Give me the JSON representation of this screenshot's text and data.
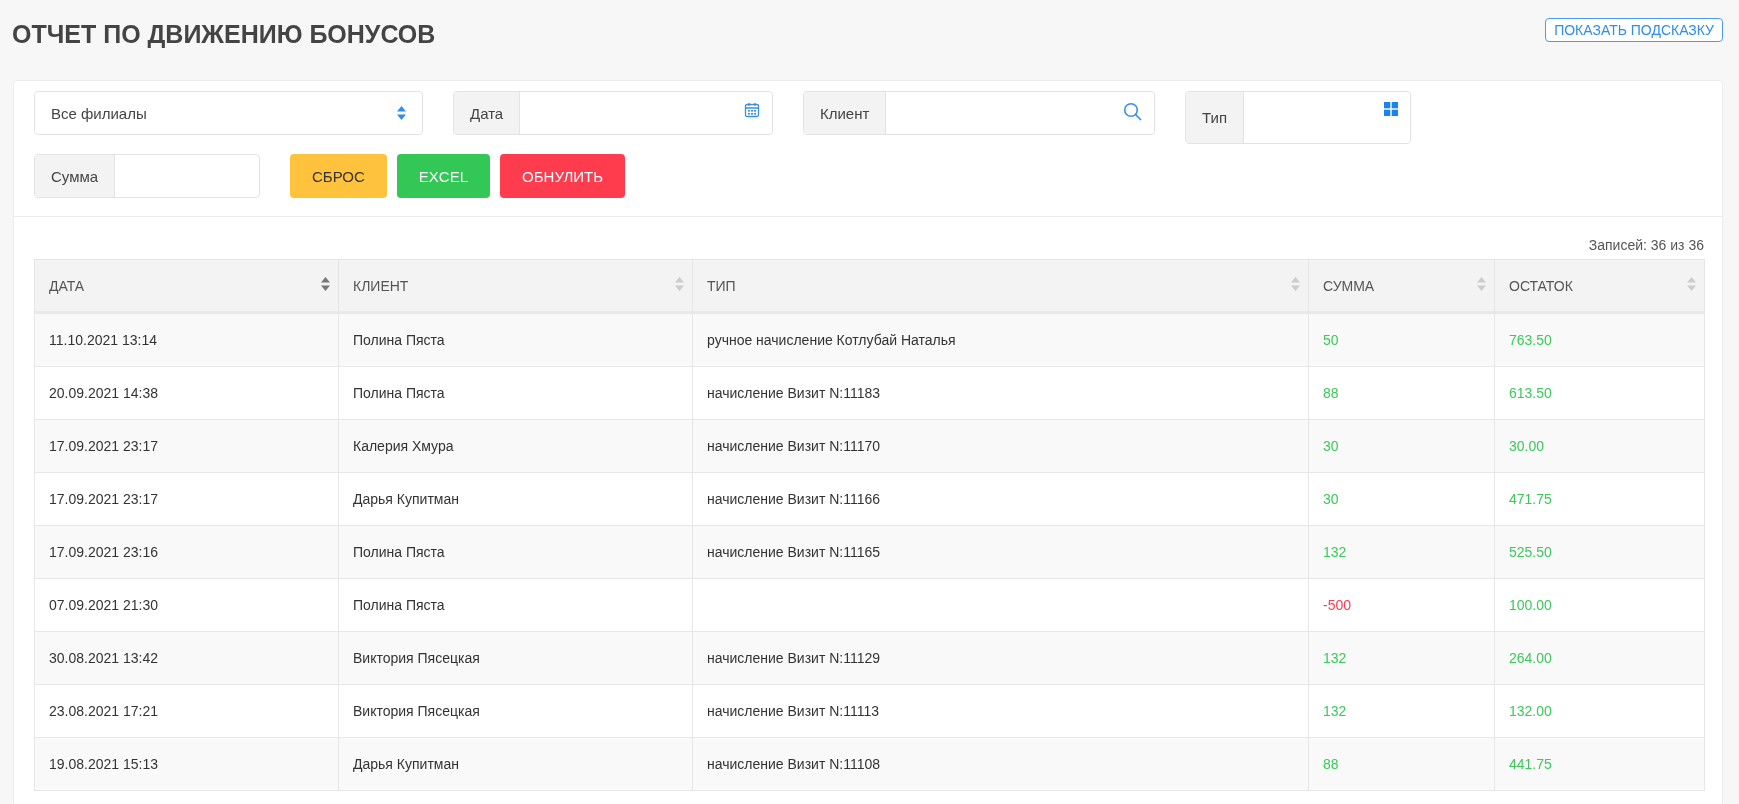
{
  "page": {
    "title": "ОТЧЕТ ПО ДВИЖЕНИЮ БОНУСОВ",
    "hint_button": "ПОКАЗАТЬ ПОДСКАЗКУ"
  },
  "filters": {
    "branch": {
      "value": "Все филиалы"
    },
    "date": {
      "label": "Дата"
    },
    "client": {
      "label": "Клиент"
    },
    "type": {
      "label": "Тип"
    },
    "sum": {
      "label": "Сумма"
    },
    "buttons": [
      {
        "label": "СБРОС",
        "kind": "warning"
      },
      {
        "label": "EXCEL",
        "kind": "success"
      },
      {
        "label": "ОБНУЛИТЬ",
        "kind": "danger"
      }
    ]
  },
  "table": {
    "records": "Записей: 36 из 36",
    "columns": [
      {
        "label": "ДАТА",
        "sorted": true
      },
      {
        "label": "КЛИЕНТ",
        "sorted": false
      },
      {
        "label": "ТИП",
        "sorted": false
      },
      {
        "label": "СУММА",
        "sorted": false
      },
      {
        "label": "ОСТАТОК",
        "sorted": false
      }
    ],
    "rows": [
      {
        "date": "11.10.2021 13:14",
        "client": "Полина Пяста",
        "type": "ручное начисление Котлубай Наталья",
        "amount": "50",
        "kind": "credit",
        "balance": "763.50"
      },
      {
        "date": "20.09.2021 14:38",
        "client": "Полина Пяста",
        "type": "начисление Визит N:11183",
        "amount": "88",
        "kind": "credit",
        "balance": "613.50"
      },
      {
        "date": "17.09.2021 23:17",
        "client": "Калерия Хмура",
        "type": "начисление Визит N:11170",
        "amount": "30",
        "kind": "credit",
        "balance": "30.00"
      },
      {
        "date": "17.09.2021 23:17",
        "client": "Дарья Купитман",
        "type": "начисление Визит N:11166",
        "amount": "30",
        "kind": "credit",
        "balance": "471.75"
      },
      {
        "date": "17.09.2021 23:16",
        "client": "Полина Пяста",
        "type": "начисление Визит N:11165",
        "amount": "132",
        "kind": "credit",
        "balance": "525.50"
      },
      {
        "date": "07.09.2021 21:30",
        "client": "Полина Пяста",
        "amount": "-500",
        "kind": "debit",
        "balance": "100.00"
      },
      {
        "date": "30.08.2021 13:42",
        "client": "Виктория Пясецкая",
        "type": "начисление Визит N:11129",
        "amount": "132",
        "kind": "credit",
        "balance": "264.00"
      },
      {
        "date": "23.08.2021 17:21",
        "client": "Виктория Пясецкая",
        "type": "начисление Визит N:11113",
        "amount": "132",
        "kind": "credit",
        "balance": "132.00"
      },
      {
        "date": "19.08.2021 15:13",
        "client": "Дарья Купитман",
        "type": "начисление Визит N:11108",
        "amount": "88",
        "kind": "credit",
        "balance": "441.75"
      }
    ]
  }
}
